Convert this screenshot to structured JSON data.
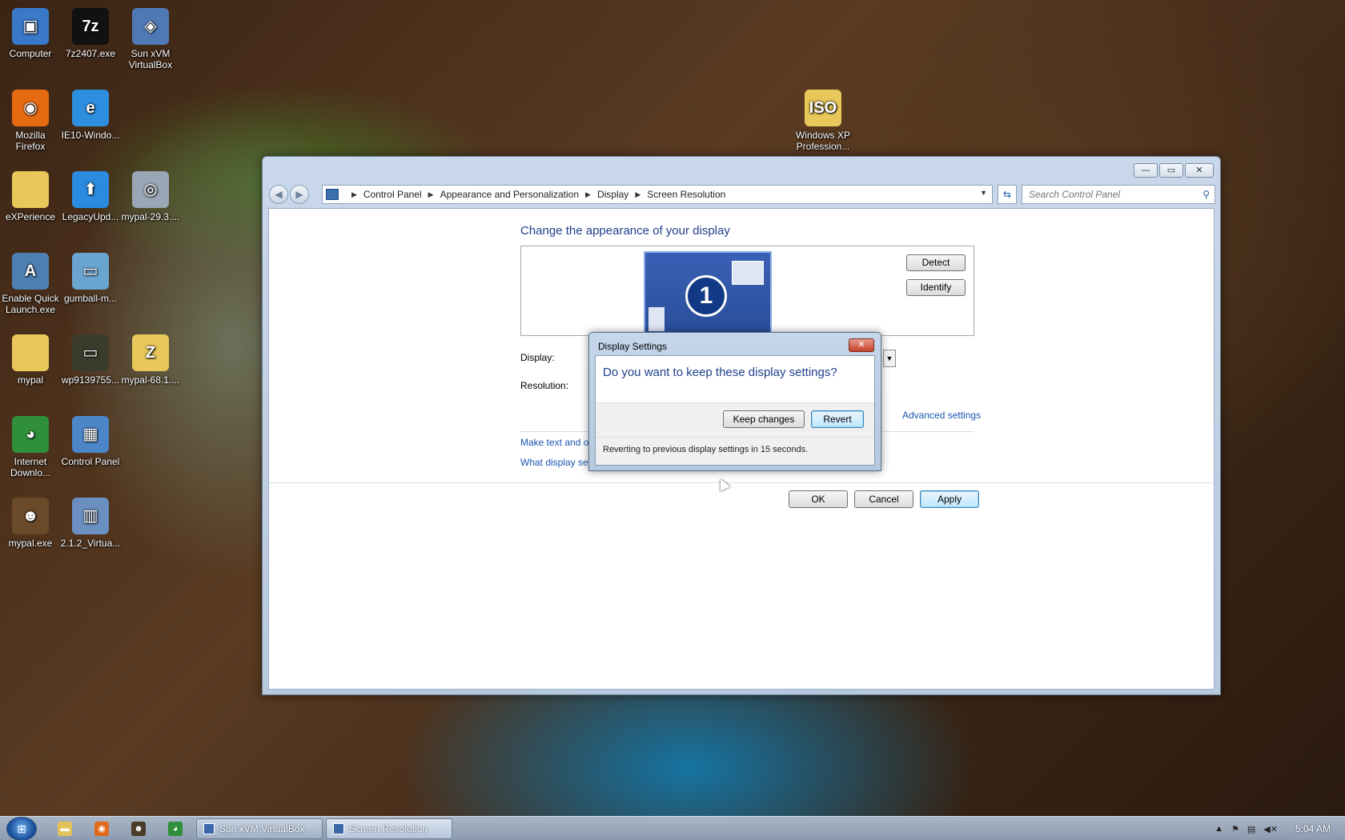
{
  "desktop": {
    "icons": [
      {
        "label": "Computer",
        "icon": "computer-icon",
        "color": "#3a78c8",
        "glyph": "▣"
      },
      {
        "label": "7z2407.exe",
        "icon": "7zip-icon",
        "color": "#111111",
        "glyph": "7z"
      },
      {
        "label": "Sun xVM VirtualBox",
        "icon": "virtualbox-icon",
        "color": "#4f79b5",
        "glyph": "◈"
      },
      {
        "label": "Mozilla Firefox",
        "icon": "firefox-icon",
        "color": "#e66a12",
        "glyph": "◉"
      },
      {
        "label": "IE10-Windo...",
        "icon": "ie-icon",
        "color": "#2e8ee0",
        "glyph": "e"
      },
      {
        "label": "Windows XP Profession...",
        "icon": "iso-folder-icon",
        "color": "#e8c85a",
        "glyph": "ISO"
      },
      {
        "label": "eXPerience",
        "icon": "folder-icon",
        "color": "#e8c85a",
        "glyph": ""
      },
      {
        "label": "LegacyUpd...",
        "icon": "legacy-update-icon",
        "color": "#2a8be0",
        "glyph": "⬆"
      },
      {
        "label": "mypal-29.3....",
        "icon": "installer-disc-icon",
        "color": "#9aa6b6",
        "glyph": "◎"
      },
      {
        "label": "Enable Quick Launch.exe",
        "icon": "quick-launch-icon",
        "color": "#4f7fb0",
        "glyph": "A"
      },
      {
        "label": "gumball-m...",
        "icon": "image-file-icon",
        "color": "#6aa5d0",
        "glyph": "▭"
      },
      {
        "label": "mypal",
        "icon": "folder-icon",
        "color": "#e8c85a",
        "glyph": ""
      },
      {
        "label": "wp9139755...",
        "icon": "image-file-icon",
        "color": "#3b3b2c",
        "glyph": "▭"
      },
      {
        "label": "mypal-68.1....",
        "icon": "zip-folder-icon",
        "color": "#e8c85a",
        "glyph": "Z"
      },
      {
        "label": "Internet Downlo...",
        "icon": "idm-icon",
        "color": "#2f8f3a",
        "glyph": "◕"
      },
      {
        "label": "Control Panel",
        "icon": "control-panel-icon",
        "color": "#4c86c8",
        "glyph": "▦"
      },
      {
        "label": "mypal.exe",
        "icon": "mypal-raccoon-icon",
        "color": "#6a4a2a",
        "glyph": "☻"
      },
      {
        "label": "2.1.2_Virtua...",
        "icon": "virtualbox-setup-icon",
        "color": "#6a8fc0",
        "glyph": "▥"
      }
    ]
  },
  "window": {
    "breadcrumb": [
      "Control Panel",
      "Appearance and Personalization",
      "Display",
      "Screen Resolution"
    ],
    "search_placeholder": "Search Control Panel",
    "controls": {
      "minimize": "—",
      "maximize": "▭",
      "close": "✕"
    },
    "heading": "Change the appearance of your display",
    "monitor_number": "1",
    "detect_label": "Detect",
    "identify_label": "Identify",
    "display_label": "Display:",
    "resolution_label": "Resolution:",
    "advanced_settings": "Advanced settings",
    "link_make_text": "Make text and ot",
    "link_what_display": "What display set",
    "ok_label": "OK",
    "cancel_label": "Cancel",
    "apply_label": "Apply"
  },
  "dialog": {
    "title": "Display Settings",
    "question": "Do you want to keep these display settings?",
    "keep_label": "Keep changes",
    "revert_label": "Revert",
    "status": "Reverting to previous display settings in 15 seconds.",
    "close": "✕"
  },
  "taskbar": {
    "tasks": [
      {
        "label": "Sun xVM VirtualBox",
        "active": false
      },
      {
        "label": "Screen Resolution",
        "active": true
      }
    ],
    "clock": "5:04 AM"
  },
  "colors": {
    "accent": "#1e3f8a",
    "link": "#1a55b0"
  }
}
